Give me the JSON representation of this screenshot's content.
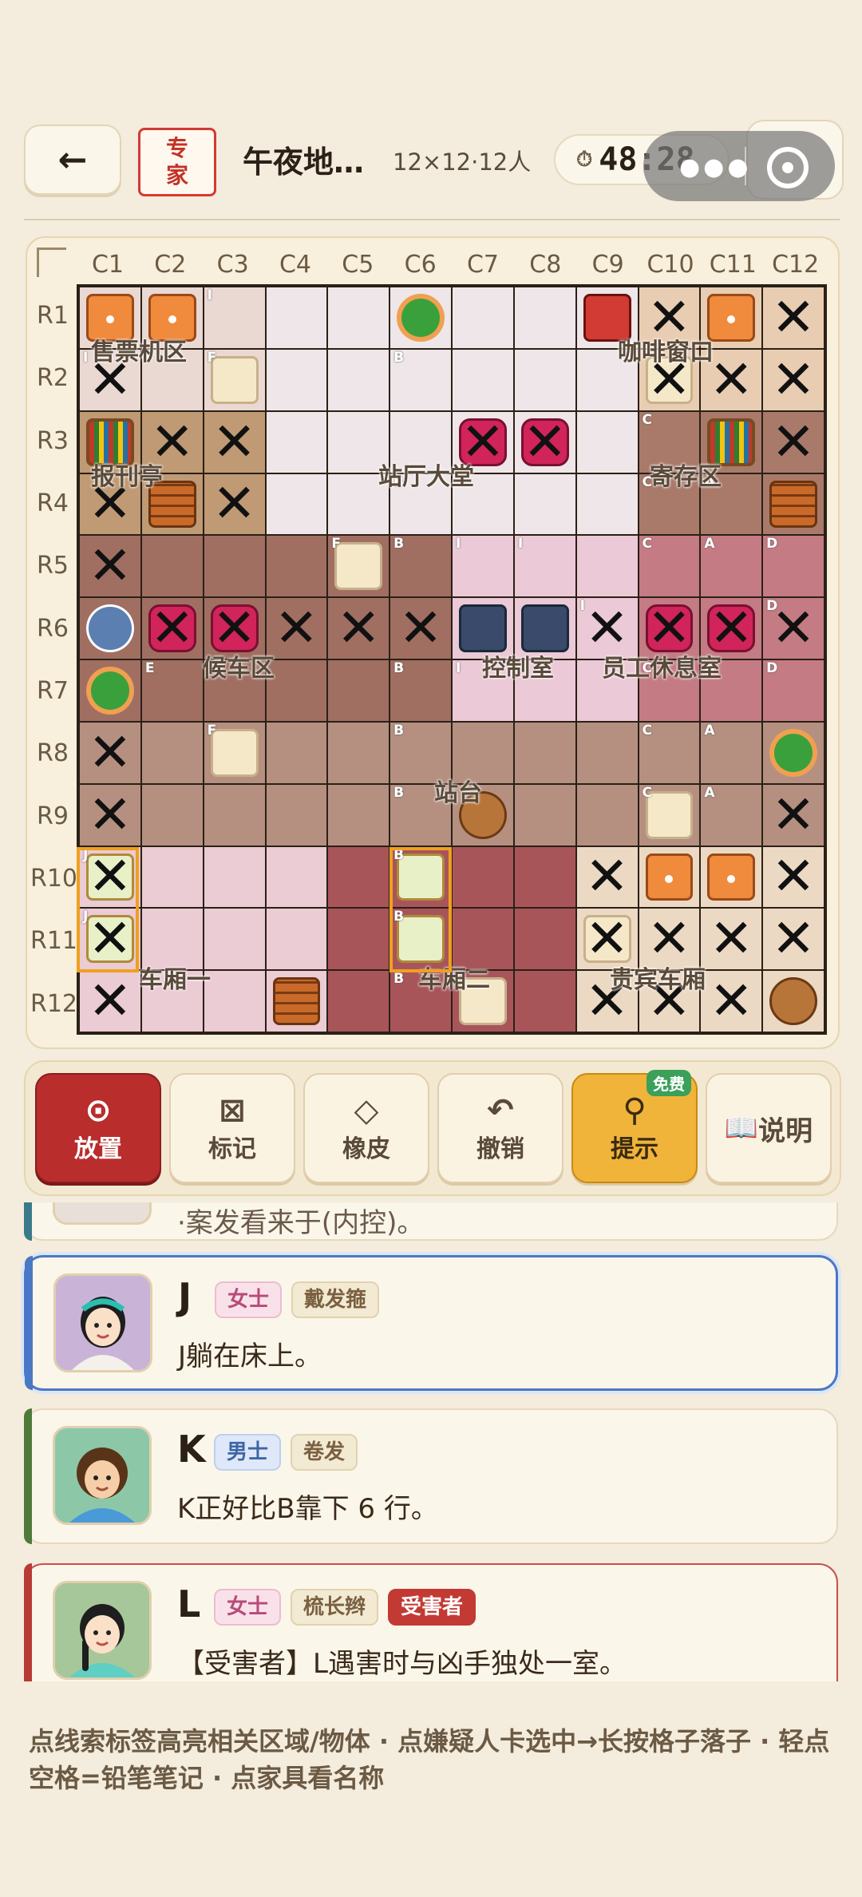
{
  "header": {
    "back_icon": "←",
    "level": "专\n家",
    "title": "午夜地…",
    "meta": "12×12·12人",
    "timer_icon": "⏱",
    "timer": "48:28"
  },
  "board": {
    "columns": [
      "C1",
      "C2",
      "C3",
      "C4",
      "C5",
      "C6",
      "C7",
      "C8",
      "C9",
      "C10",
      "C11",
      "C12"
    ],
    "rows": [
      "R1",
      "R2",
      "R3",
      "R4",
      "R5",
      "R6",
      "R7",
      "R8",
      "R9",
      "R10",
      "R11",
      "R12"
    ],
    "room_labels": [
      "售票机区",
      "咖啡窗口",
      "报刊亭",
      "站厅大堂",
      "寄存区",
      "候车区",
      "控制室",
      "员工休息室",
      "站台",
      "车厢一",
      "车厢二",
      "贵宾车厢"
    ],
    "x_mark": "✕",
    "cell_tags": {
      "I": "I",
      "B": "B",
      "F": "F",
      "C": "C",
      "A": "A",
      "D": "D",
      "E": "E",
      "J": "J"
    },
    "colors": {
      "lobby": "#eee6e8",
      "ticket": "#ead8d2",
      "kiosk": "#bf9a74",
      "coffee": "#e8cdb2",
      "storage": "#a97a6a",
      "waiting": "#a06f62",
      "control": "#ebc9d6",
      "staff": "#c47b84",
      "platform": "#b59080",
      "car1": "#ebcbd4",
      "car2": "#a8555a",
      "vip": "#ecd9c4",
      "selection": "#f0a020"
    }
  },
  "toolbar": {
    "place": {
      "icon": "⊙",
      "label": "放置"
    },
    "mark": {
      "icon": "⊠",
      "label": "标记"
    },
    "eraser": {
      "icon": "◇",
      "label": "橡皮"
    },
    "undo": {
      "icon": "↶",
      "label": "撤销"
    },
    "hint": {
      "icon": "⚲",
      "label": "提示",
      "badge": "免费"
    },
    "help": {
      "icon": "📖",
      "label": "说明"
    }
  },
  "suspects": [
    {
      "name": "J",
      "gender": "女士",
      "trait": "戴发箍",
      "clue": "J躺在床上。",
      "accent": "#4a78c4"
    },
    {
      "name": "K",
      "gender": "男士",
      "trait": "卷发",
      "clue": "K正好比B靠下 6 行。",
      "accent": "#4f7a3a"
    },
    {
      "name": "L",
      "gender": "女士",
      "trait": "梳长辫",
      "victim": "受害者",
      "clue": "【受害者】L遇害时与凶手独处一室。",
      "accent": "#b83a36"
    }
  ],
  "partial_card_text": "·案发看来于(内控)。",
  "footer_tip": "点线索标签高亮相关区域/物体 · 点嫌疑人卡选中→长按格子落子 · 轻点空格=铅笔笔记 · 点家具看名称"
}
